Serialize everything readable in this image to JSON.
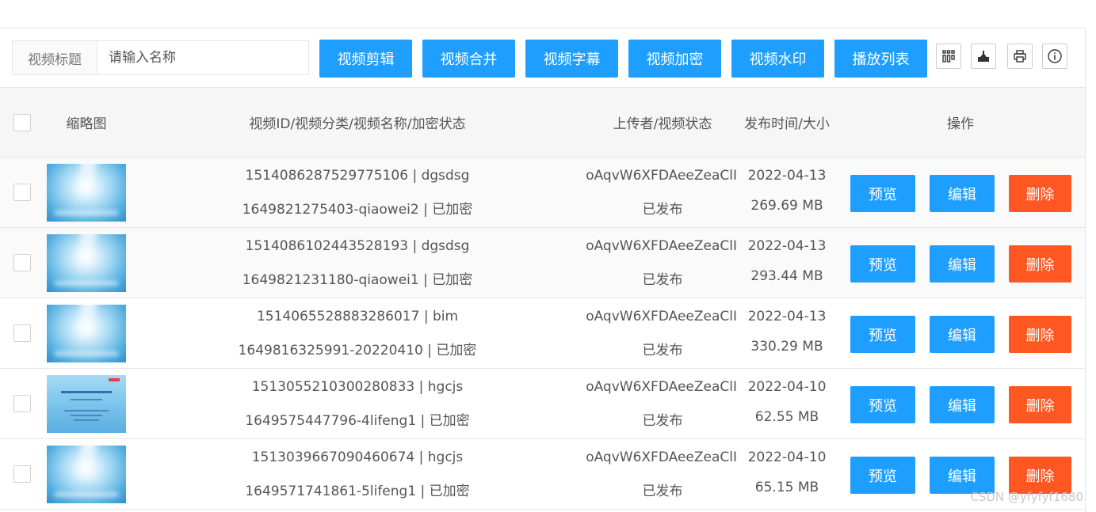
{
  "search": {
    "label": "视频标题",
    "placeholder": "请输入名称",
    "value": ""
  },
  "toolbar": {
    "buttons": [
      "视频剪辑",
      "视频合并",
      "视频字幕",
      "视频加密",
      "视频水印",
      "播放列表"
    ],
    "icons": [
      "columns-icon",
      "export-icon",
      "print-icon",
      "info-icon"
    ]
  },
  "table": {
    "headers": {
      "thumbnail": "缩略图",
      "info": "视频ID/视频分类/视频名称/加密状态",
      "uploader": "上传者/视频状态",
      "date_size": "发布时间/大小",
      "actions": "操作"
    },
    "action_labels": {
      "preview": "预览",
      "edit": "编辑",
      "delete": "删除"
    },
    "rows": [
      {
        "line1": "1514086287529775106 | dgsdsg",
        "line2": "1649821275403-qiaowei2 | 已加密",
        "uploader": "oAqvW6XFDAeeZeaClI",
        "status": "已发布",
        "date": "2022-04-13",
        "size": "269.69 MB",
        "thumb": "light"
      },
      {
        "line1": "1514086102443528193 | dgsdsg",
        "line2": "1649821231180-qiaowei1 | 已加密",
        "uploader": "oAqvW6XFDAeeZeaClI",
        "status": "已发布",
        "date": "2022-04-13",
        "size": "293.44 MB",
        "thumb": "light"
      },
      {
        "line1": "1514065528883286017 | bim",
        "line2": "1649816325991-20220410 | 已加密",
        "uploader": "oAqvW6XFDAeeZeaClI",
        "status": "已发布",
        "date": "2022-04-13",
        "size": "330.29 MB",
        "thumb": "light"
      },
      {
        "line1": "1513055210300280833 | hgcjs",
        "line2": "1649575447796-4lifeng1 | 已加密",
        "uploader": "oAqvW6XFDAeeZeaClI",
        "status": "已发布",
        "date": "2022-04-10",
        "size": "62.55 MB",
        "thumb": "doc"
      },
      {
        "line1": "1513039667090460674 | hgcjs",
        "line2": "1649571741861-5lifeng1 | 已加密",
        "uploader": "oAqvW6XFDAeeZeaClI",
        "status": "已发布",
        "date": "2022-04-10",
        "size": "65.15 MB",
        "thumb": "light"
      }
    ]
  },
  "watermark": "CSDN @yfyfyf1680",
  "colors": {
    "primary": "#1e9fff",
    "danger": "#ff5722",
    "header_bg": "#f6f6f6",
    "border": "#e6e6e6"
  }
}
